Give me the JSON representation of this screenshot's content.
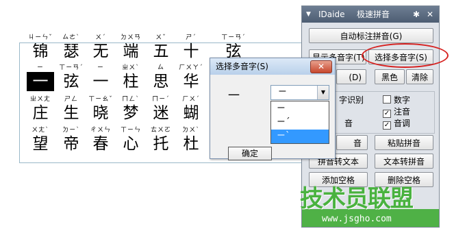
{
  "doc": {
    "rows": [
      [
        {
          "hz": "锦",
          "py": "ㄐㄧㄣˇ"
        },
        {
          "hz": "瑟",
          "py": "ㄙㄜˋ"
        },
        {
          "hz": "无",
          "py": "ㄨˊ"
        },
        {
          "hz": "端",
          "py": "ㄉㄨㄢ"
        },
        {
          "hz": "五",
          "py": "ㄨˇ"
        },
        {
          "hz": "十",
          "py": "ㄕˊ"
        },
        {
          "hz": "弦",
          "py": "ㄒㄧㄢˊ"
        }
      ],
      [
        {
          "hz": "一",
          "py": "ㄧ",
          "selected": true
        },
        {
          "hz": "弦",
          "py": "ㄒㄧㄢˊ"
        },
        {
          "hz": "一",
          "py": "ㄧ"
        },
        {
          "hz": "柱",
          "py": "ㄓㄨˋ"
        },
        {
          "hz": "思",
          "py": "ㄙ"
        },
        {
          "hz": "华",
          "py": "ㄏㄨㄚˊ"
        }
      ],
      [
        {
          "hz": "庄",
          "py": "ㄓㄨㄤ"
        },
        {
          "hz": "生",
          "py": "ㄕㄥ"
        },
        {
          "hz": "晓",
          "py": "ㄒㄧㄠˇ"
        },
        {
          "hz": "梦",
          "py": "ㄇㄥˋ"
        },
        {
          "hz": "迷",
          "py": "ㄇㄧˊ"
        },
        {
          "hz": "蝴",
          "py": "ㄏㄨˊ"
        }
      ],
      [
        {
          "hz": "望",
          "py": "ㄨㄤˋ"
        },
        {
          "hz": "帝",
          "py": "ㄉㄧˋ"
        },
        {
          "hz": "春",
          "py": "ㄔㄨㄣ"
        },
        {
          "hz": "心",
          "py": "ㄒㄧㄣ"
        },
        {
          "hz": "托",
          "py": "ㄊㄨㄛ"
        },
        {
          "hz": "杜",
          "py": "ㄉㄨˋ"
        }
      ]
    ]
  },
  "palette": {
    "title": "IDaide",
    "subtitle": "极速拼音",
    "menu_icon": "triangle-down-icon",
    "settings_icon": "gear-icon",
    "close_icon": "close-icon",
    "btn_auto": "自动标注拼音(G)",
    "btn_show_multi": "显示多音字(T)",
    "btn_select_multi": "选择多音字(S)",
    "btn_partial": "(D)",
    "btn_black": "黑色",
    "btn_clear": "清除",
    "group_label": "字识别",
    "opt_digit": "数字",
    "opt_zhuyin": "注音",
    "opt_tone": "音调",
    "opt_partial_left": "音",
    "btn_copy_pinyin": "音",
    "btn_paste_pinyin": "粘贴拼音",
    "btn_pinyin_to_text": "拼音转文本",
    "btn_text_to_pinyin": "文本转拼音",
    "btn_add_space": "添加空格",
    "btn_del_space": "删除空格",
    "checked": {
      "digit": false,
      "zhuyin": true,
      "tone": true
    },
    "accent": "#d6201e"
  },
  "dialog": {
    "title": "选择多音字(S)",
    "close_icon": "close-icon",
    "char": "一",
    "combo_value": "ㄧ",
    "options": [
      "ㄧ",
      "ㄧˊ",
      "ㄧˋ"
    ],
    "highlighted_index": 2,
    "ok_label": "确定"
  },
  "watermark": {
    "main": "技术员联盟",
    "url": "www.jsgho.com"
  }
}
